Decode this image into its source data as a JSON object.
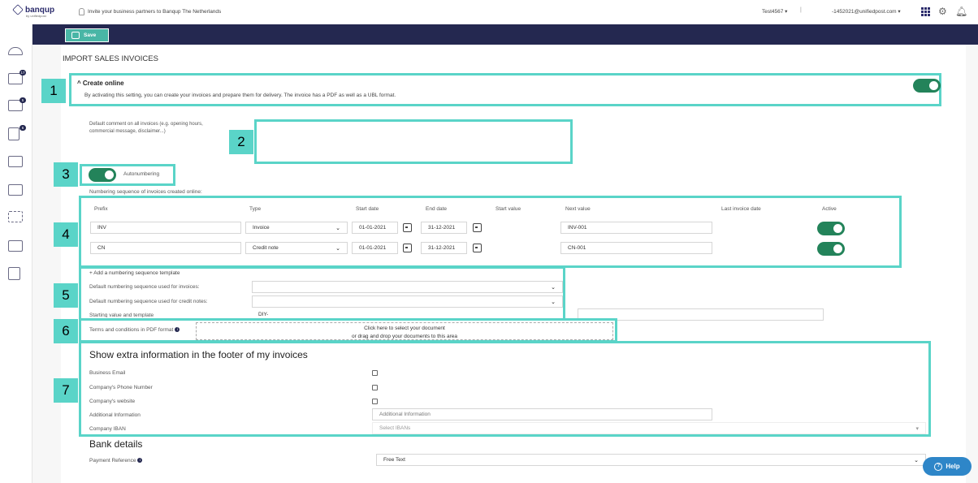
{
  "brand": {
    "name": "banqup",
    "sub": "by unifiedpost"
  },
  "topbar": {
    "invite": "Invite your business partners to Banqup The Netherlands",
    "company": "Test4567 ▾",
    "separator": "|",
    "user": "-1452021@unifiedpost.com ▾"
  },
  "toolbar": {
    "save_label": "Save"
  },
  "sidebar": {
    "badges": [
      "17",
      "5",
      "6"
    ]
  },
  "page": {
    "title": "IMPORT SALES INVOICES"
  },
  "callouts": [
    "1",
    "2",
    "3",
    "4",
    "5",
    "6",
    "7"
  ],
  "create_online": {
    "title": "Create online",
    "description": "By activating this setting, you can create your invoices and prepare them for delivery. The invoice has a PDF as well as a UBL format.",
    "enabled": true
  },
  "default_comment": {
    "label_line1": "Default comment on all invoices (e.g. opening hours,",
    "label_line2": "commercial message, disclaimer...)",
    "value": ""
  },
  "autonumbering": {
    "label": "Autonumbering",
    "enabled": true
  },
  "numbering": {
    "caption": "Numbering sequence of invoices created online:",
    "headers": [
      "Prefix",
      "Type",
      "Start date",
      "End date",
      "Start value",
      "Next value",
      "Last invoice date",
      "Active"
    ],
    "rows": [
      {
        "prefix": "INV",
        "type": "Invoice",
        "start_date": "01-01-2021",
        "end_date": "31-12-2021",
        "next_value": "INV-001",
        "active": true
      },
      {
        "prefix": "CN",
        "type": "Credit note",
        "start_date": "01-01-2021",
        "end_date": "31-12-2021",
        "next_value": "CN-001",
        "active": true
      }
    ]
  },
  "templates": {
    "add_link": "+ Add a numbering sequence template",
    "invoices_label": "Default numbering sequence used for invoices:",
    "credit_notes_label": "Default numbering sequence used for credit notes:",
    "start_value_label": "Starting value and template",
    "start_value": "DIY-"
  },
  "terms": {
    "label": "Terms and conditions in PDF format",
    "drop_line1": "Click here to select your document",
    "drop_line2": "or drag and drop your documents to this area"
  },
  "footer_info": {
    "heading": "Show extra information in the footer of my invoices",
    "business_email": "Business Email",
    "phone": "Company's Phone Number",
    "website": "Company's website",
    "additional_label": "Additional Information",
    "additional_placeholder": "Additional Information",
    "iban_label": "Company IBAN",
    "iban_placeholder": "Select IBANs"
  },
  "bank": {
    "heading": "Bank details",
    "payment_ref_label": "Payment Reference",
    "payment_ref_value": "Free Text"
  },
  "help": {
    "label": "Help"
  },
  "colors": {
    "accent": "#5ad4c8",
    "navy": "#242850",
    "toggle": "#23835a",
    "save": "#49b6a6",
    "help": "#2e86c8"
  }
}
